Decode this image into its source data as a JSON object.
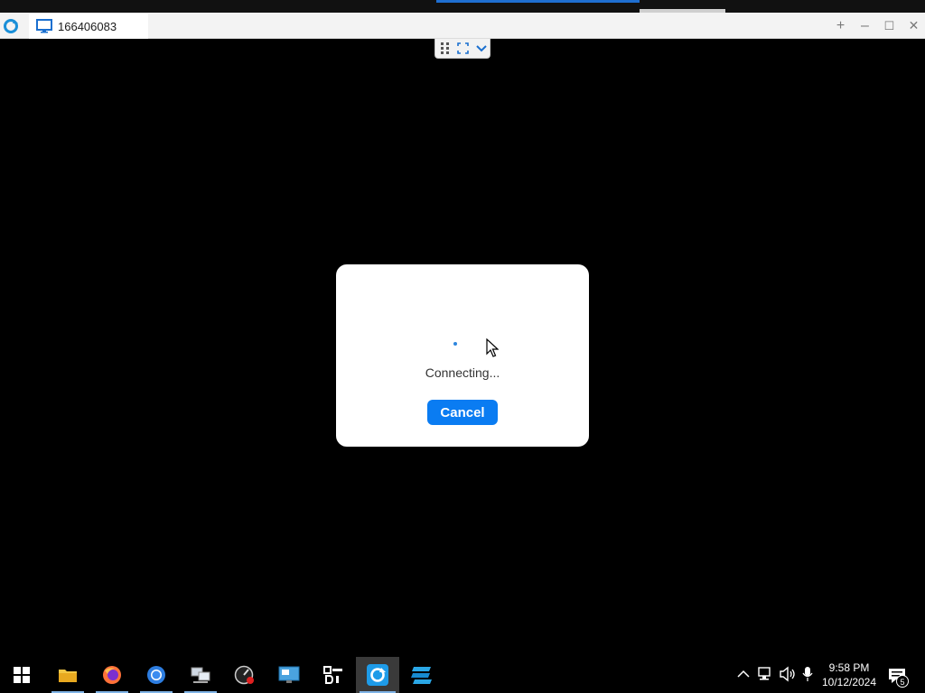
{
  "window": {
    "tab_title": "166406083",
    "controls": [
      "+",
      "–",
      "☐",
      "✕"
    ]
  },
  "dialog": {
    "status_text": "Connecting...",
    "cancel_label": "Cancel"
  },
  "taskbar": {
    "pinned_apps": [
      "start",
      "file-explorer",
      "firefox",
      "chrome",
      "network-connections",
      "speedometer-tool",
      "remote-desktop-connection",
      "di-tool",
      "remote-app",
      "blue-stripes-app"
    ],
    "active_app": "remote-app"
  },
  "tray": {
    "time": "9:58 PM",
    "date": "10/12/2024",
    "notification_count": "5"
  },
  "colors": {
    "accent": "#0a7cf2",
    "background": "#000000"
  }
}
